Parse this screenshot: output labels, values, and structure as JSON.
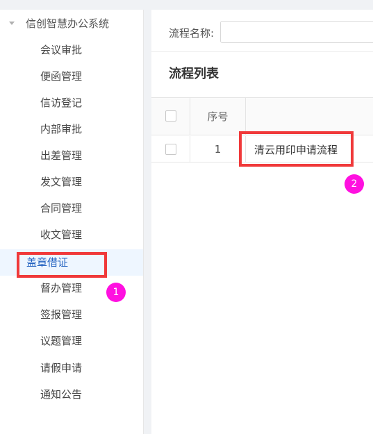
{
  "sidebar": {
    "group_title": "信创智慧办公系统",
    "items": [
      {
        "label": "会议审批"
      },
      {
        "label": "便函管理"
      },
      {
        "label": "信访登记"
      },
      {
        "label": "内部审批"
      },
      {
        "label": "出差管理"
      },
      {
        "label": "发文管理"
      },
      {
        "label": "合同管理"
      },
      {
        "label": "收文管理"
      },
      {
        "label": "盖章借证",
        "active": true
      },
      {
        "label": "督办管理"
      },
      {
        "label": "签报管理"
      },
      {
        "label": "议题管理"
      },
      {
        "label": "请假申请"
      },
      {
        "label": "通知公告"
      }
    ]
  },
  "filter": {
    "label": "流程名称:",
    "value": "",
    "placeholder": ""
  },
  "list": {
    "title": "流程列表",
    "columns": {
      "index": "序号"
    },
    "rows": [
      {
        "index": "1",
        "name": "清云用印申请流程"
      }
    ]
  },
  "annotations": {
    "badge1": "1",
    "badge2": "2"
  },
  "colors": {
    "highlight": "#f0393a",
    "badge": "#ff10e0",
    "active_bg": "#eef6ff"
  }
}
